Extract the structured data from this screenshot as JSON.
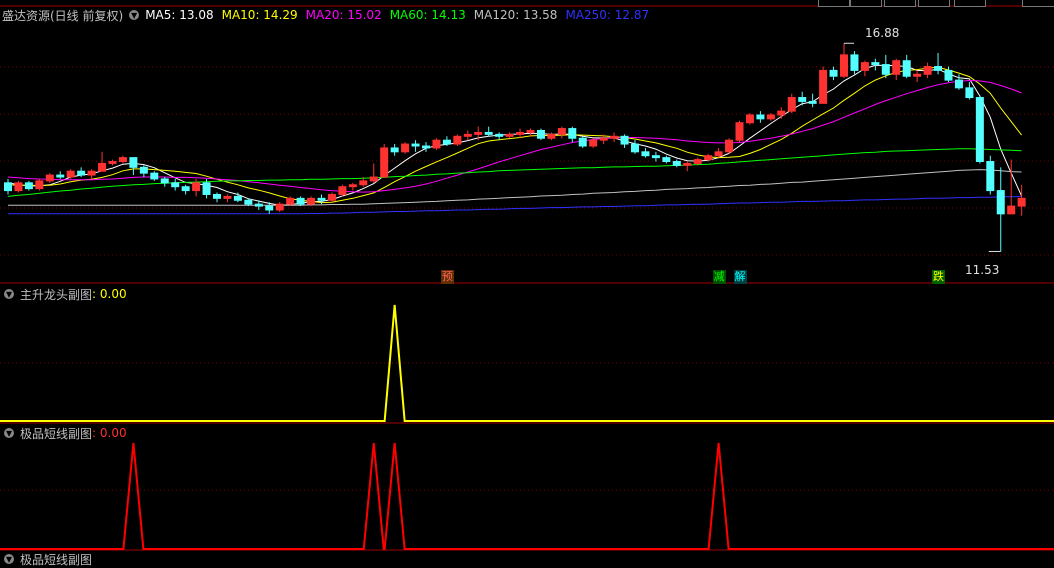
{
  "main": {
    "title": "盛达资源(日线 前复权)",
    "ma_labels": [
      {
        "name": "MA5",
        "text": "MA5: 13.08",
        "color": "#ffffff"
      },
      {
        "name": "MA10",
        "text": "MA10: 14.29",
        "color": "#ffff00"
      },
      {
        "name": "MA20",
        "text": "MA20: 15.02",
        "color": "#ff00ff"
      },
      {
        "name": "MA60",
        "text": "MA60: 14.13",
        "color": "#00ff00"
      },
      {
        "name": "MA120",
        "text": "MA120: 13.58",
        "color": "#c0c0c0"
      },
      {
        "name": "MA250",
        "text": "MA250: 12.87",
        "color": "#3030ff"
      }
    ],
    "high_label": "16.88",
    "low_label": "11.53",
    "signals": [
      {
        "text": "预",
        "color": "#ff6060",
        "bg": "#603000"
      },
      {
        "text": "减",
        "color": "#00ff00",
        "bg": "#005000"
      },
      {
        "text": "解",
        "color": "#00ffff",
        "bg": "#004040"
      },
      {
        "text": "跌",
        "color": "#ffff00",
        "bg": "#006000"
      }
    ]
  },
  "sub1": {
    "title": "主升龙头副图",
    "value": ": 0.00",
    "line_color": "#ffff00"
  },
  "sub2": {
    "title": "极品短线副图",
    "value": ": 0.00",
    "line_color": "#ff0000"
  },
  "sub3": {
    "title": "极品短线副图"
  },
  "chart_data": {
    "type": "candlestick",
    "y_range": [
      11.0,
      17.5
    ],
    "candles": [
      [
        13.3,
        13.4,
        13.0,
        13.1
      ],
      [
        13.1,
        13.35,
        13.05,
        13.3
      ],
      [
        13.3,
        13.35,
        13.1,
        13.15
      ],
      [
        13.15,
        13.4,
        13.1,
        13.35
      ],
      [
        13.35,
        13.55,
        13.3,
        13.5
      ],
      [
        13.5,
        13.6,
        13.4,
        13.45
      ],
      [
        13.45,
        13.65,
        13.4,
        13.6
      ],
      [
        13.6,
        13.7,
        13.45,
        13.5
      ],
      [
        13.5,
        13.65,
        13.4,
        13.6
      ],
      [
        13.6,
        14.1,
        13.6,
        13.8
      ],
      [
        13.8,
        13.9,
        13.75,
        13.85
      ],
      [
        13.85,
        14.0,
        13.8,
        13.95
      ],
      [
        13.95,
        13.95,
        13.5,
        13.7
      ],
      [
        13.7,
        13.75,
        13.45,
        13.55
      ],
      [
        13.55,
        13.6,
        13.35,
        13.4
      ],
      [
        13.4,
        13.45,
        13.2,
        13.3
      ],
      [
        13.3,
        13.4,
        13.1,
        13.2
      ],
      [
        13.2,
        13.25,
        13.0,
        13.1
      ],
      [
        13.1,
        13.4,
        12.95,
        13.3
      ],
      [
        13.3,
        13.4,
        12.9,
        13.0
      ],
      [
        13.0,
        13.05,
        12.8,
        12.9
      ],
      [
        12.9,
        13.0,
        12.8,
        12.95
      ],
      [
        12.95,
        13.05,
        12.8,
        12.85
      ],
      [
        12.85,
        12.9,
        12.7,
        12.75
      ],
      [
        12.75,
        12.85,
        12.6,
        12.7
      ],
      [
        12.7,
        12.8,
        12.5,
        12.6
      ],
      [
        12.6,
        12.8,
        12.55,
        12.75
      ],
      [
        12.75,
        12.95,
        12.7,
        12.9
      ],
      [
        12.9,
        12.95,
        12.7,
        12.75
      ],
      [
        12.75,
        12.95,
        12.7,
        12.9
      ],
      [
        12.9,
        13.0,
        12.75,
        12.85
      ],
      [
        12.85,
        13.05,
        12.8,
        13.0
      ],
      [
        13.0,
        13.25,
        12.95,
        13.2
      ],
      [
        13.2,
        13.3,
        13.1,
        13.25
      ],
      [
        13.25,
        13.45,
        13.2,
        13.35
      ],
      [
        13.35,
        13.8,
        13.3,
        13.45
      ],
      [
        13.45,
        14.3,
        13.45,
        14.2
      ],
      [
        14.2,
        14.3,
        14.0,
        14.1
      ],
      [
        14.1,
        14.35,
        14.05,
        14.3
      ],
      [
        14.3,
        14.4,
        14.1,
        14.25
      ],
      [
        14.25,
        14.35,
        14.1,
        14.2
      ],
      [
        14.2,
        14.45,
        14.15,
        14.4
      ],
      [
        14.4,
        14.5,
        14.25,
        14.3
      ],
      [
        14.3,
        14.55,
        14.25,
        14.5
      ],
      [
        14.5,
        14.65,
        14.4,
        14.55
      ],
      [
        14.55,
        14.75,
        14.4,
        14.6
      ],
      [
        14.6,
        14.75,
        14.5,
        14.55
      ],
      [
        14.55,
        14.6,
        14.4,
        14.5
      ],
      [
        14.5,
        14.6,
        14.45,
        14.55
      ],
      [
        14.55,
        14.7,
        14.45,
        14.6
      ],
      [
        14.6,
        14.7,
        14.5,
        14.65
      ],
      [
        14.65,
        14.7,
        14.4,
        14.45
      ],
      [
        14.45,
        14.6,
        14.4,
        14.55
      ],
      [
        14.55,
        14.75,
        14.45,
        14.7
      ],
      [
        14.7,
        14.75,
        14.35,
        14.45
      ],
      [
        14.45,
        14.5,
        14.2,
        14.25
      ],
      [
        14.25,
        14.45,
        14.2,
        14.4
      ],
      [
        14.4,
        14.55,
        14.3,
        14.45
      ],
      [
        14.45,
        14.6,
        14.35,
        14.5
      ],
      [
        14.5,
        14.55,
        14.2,
        14.3
      ],
      [
        14.3,
        14.4,
        14.05,
        14.1
      ],
      [
        14.1,
        14.2,
        13.95,
        14.0
      ],
      [
        14.0,
        14.1,
        13.85,
        13.95
      ],
      [
        13.95,
        14.0,
        13.8,
        13.85
      ],
      [
        13.85,
        13.9,
        13.7,
        13.75
      ],
      [
        13.75,
        13.85,
        13.6,
        13.8
      ],
      [
        13.8,
        13.95,
        13.75,
        13.9
      ],
      [
        13.9,
        14.05,
        13.85,
        14.0
      ],
      [
        14.0,
        14.2,
        13.95,
        14.1
      ],
      [
        14.1,
        14.45,
        14.05,
        14.4
      ],
      [
        14.4,
        14.9,
        14.35,
        14.85
      ],
      [
        14.85,
        15.1,
        14.8,
        15.05
      ],
      [
        15.05,
        15.15,
        14.85,
        14.95
      ],
      [
        14.95,
        15.1,
        14.9,
        15.05
      ],
      [
        15.05,
        15.25,
        14.95,
        15.15
      ],
      [
        15.15,
        15.6,
        15.1,
        15.5
      ],
      [
        15.5,
        15.65,
        15.3,
        15.4
      ],
      [
        15.4,
        15.6,
        15.25,
        15.35
      ],
      [
        15.35,
        16.3,
        15.35,
        16.2
      ],
      [
        16.2,
        16.3,
        15.95,
        16.05
      ],
      [
        16.05,
        16.9,
        16.0,
        16.6
      ],
      [
        16.6,
        16.7,
        16.1,
        16.2
      ],
      [
        16.2,
        16.45,
        16.05,
        16.4
      ],
      [
        16.4,
        16.5,
        16.2,
        16.35
      ],
      [
        16.35,
        16.6,
        16.0,
        16.1
      ],
      [
        16.1,
        16.5,
        15.95,
        16.45
      ],
      [
        16.45,
        16.6,
        16.0,
        16.05
      ],
      [
        16.05,
        16.2,
        15.9,
        16.1
      ],
      [
        16.1,
        16.4,
        16.0,
        16.3
      ],
      [
        16.3,
        16.65,
        16.1,
        16.2
      ],
      [
        16.2,
        16.3,
        15.9,
        15.95
      ],
      [
        15.95,
        16.1,
        15.7,
        15.75
      ],
      [
        15.75,
        15.9,
        15.45,
        15.5
      ],
      [
        15.5,
        15.55,
        13.8,
        13.85
      ],
      [
        13.85,
        14.0,
        13.0,
        13.1
      ],
      [
        13.1,
        13.7,
        11.53,
        12.5
      ],
      [
        12.5,
        13.9,
        12.5,
        12.7
      ],
      [
        12.7,
        13.25,
        12.45,
        12.9
      ]
    ],
    "ma": {
      "MA5": [
        13.3,
        13.25,
        13.22,
        13.22,
        13.25,
        13.34,
        13.45,
        13.5,
        13.53,
        13.61,
        13.68,
        13.78,
        13.8,
        13.77,
        13.69,
        13.56,
        13.43,
        13.31,
        13.28,
        13.24,
        13.18,
        13.07,
        13.0,
        12.89,
        12.83,
        12.77,
        12.72,
        12.73,
        12.78,
        12.81,
        12.82,
        12.87,
        12.96,
        13.04,
        13.15,
        13.28,
        13.49,
        13.68,
        13.87,
        14.05,
        14.19,
        14.26,
        14.29,
        14.33,
        14.39,
        14.46,
        14.5,
        14.53,
        14.55,
        14.56,
        14.58,
        14.57,
        14.55,
        14.56,
        14.55,
        14.5,
        14.46,
        14.46,
        14.46,
        14.38,
        14.31,
        14.25,
        14.17,
        14.04,
        13.94,
        13.87,
        13.86,
        13.88,
        13.95,
        14.06,
        14.25,
        14.45,
        14.64,
        14.83,
        15.01,
        15.19,
        15.34,
        15.39,
        15.57,
        15.72,
        15.93,
        16.08,
        16.25,
        16.33,
        16.33,
        16.32,
        16.3,
        16.2,
        16.19,
        16.23,
        16.11,
        16.01,
        15.98,
        15.54,
        14.99,
        14.17,
        13.55,
        12.96
      ],
      "MA10": [
        13.25,
        13.24,
        13.24,
        13.23,
        13.24,
        13.27,
        13.33,
        13.37,
        13.39,
        13.44,
        13.51,
        13.61,
        13.66,
        13.66,
        13.64,
        13.62,
        13.6,
        13.57,
        13.54,
        13.47,
        13.39,
        13.32,
        13.25,
        13.17,
        13.11,
        13.04,
        12.96,
        12.89,
        12.85,
        12.82,
        12.79,
        12.8,
        12.85,
        12.9,
        12.97,
        13.04,
        13.18,
        13.33,
        13.46,
        13.6,
        13.72,
        13.84,
        13.95,
        14.07,
        14.19,
        14.31,
        14.38,
        14.41,
        14.44,
        14.47,
        14.51,
        14.52,
        14.52,
        14.53,
        14.54,
        14.53,
        14.52,
        14.51,
        14.49,
        14.47,
        14.43,
        14.38,
        14.33,
        14.26,
        14.19,
        14.09,
        14.02,
        13.97,
        13.95,
        13.96,
        13.98,
        14.06,
        14.16,
        14.29,
        14.42,
        14.58,
        14.76,
        14.92,
        15.08,
        15.23,
        15.43,
        15.61,
        15.8,
        15.95,
        16.06,
        16.15,
        16.2,
        16.22,
        16.26,
        16.28,
        16.21,
        16.13,
        16.04,
        15.85,
        15.61,
        15.23,
        14.88,
        14.53
      ],
      "MA20": [
        13.45,
        13.43,
        13.41,
        13.4,
        13.39,
        13.38,
        13.38,
        13.38,
        13.38,
        13.39,
        13.4,
        13.42,
        13.44,
        13.45,
        13.45,
        13.45,
        13.44,
        13.44,
        13.43,
        13.42,
        13.4,
        13.38,
        13.36,
        13.33,
        13.3,
        13.27,
        13.24,
        13.21,
        13.18,
        13.15,
        13.12,
        13.1,
        13.08,
        13.07,
        13.06,
        13.07,
        13.1,
        13.13,
        13.17,
        13.21,
        13.27,
        13.34,
        13.42,
        13.5,
        13.58,
        13.66,
        13.75,
        13.84,
        13.92,
        14.0,
        14.08,
        14.16,
        14.22,
        14.28,
        14.34,
        14.38,
        14.42,
        14.44,
        14.46,
        14.47,
        14.47,
        14.46,
        14.45,
        14.43,
        14.41,
        14.38,
        14.36,
        14.34,
        14.33,
        14.33,
        14.34,
        14.37,
        14.41,
        14.45,
        14.5,
        14.56,
        14.63,
        14.7,
        14.79,
        14.88,
        14.99,
        15.1,
        15.21,
        15.32,
        15.42,
        15.51,
        15.6,
        15.68,
        15.76,
        15.83,
        15.88,
        15.92,
        15.94,
        15.93,
        15.89,
        15.81,
        15.72,
        15.62
      ],
      "MA60": [
        12.95,
        12.98,
        13.0,
        13.03,
        13.06,
        13.09,
        13.11,
        13.14,
        13.16,
        13.19,
        13.21,
        13.23,
        13.25,
        13.26,
        13.28,
        13.29,
        13.3,
        13.31,
        13.32,
        13.33,
        13.34,
        13.35,
        13.35,
        13.36,
        13.36,
        13.37,
        13.37,
        13.38,
        13.38,
        13.39,
        13.39,
        13.4,
        13.41,
        13.41,
        13.42,
        13.43,
        13.44,
        13.46,
        13.47,
        13.49,
        13.5,
        13.52,
        13.53,
        13.55,
        13.56,
        13.58,
        13.59,
        13.61,
        13.62,
        13.63,
        13.64,
        13.65,
        13.66,
        13.67,
        13.68,
        13.69,
        13.69,
        13.7,
        13.71,
        13.71,
        13.72,
        13.73,
        13.73,
        13.74,
        13.75,
        13.76,
        13.77,
        13.78,
        13.8,
        13.82,
        13.84,
        13.86,
        13.88,
        13.9,
        13.92,
        13.94,
        13.96,
        13.98,
        14.0,
        14.02,
        14.04,
        14.06,
        14.08,
        14.09,
        14.11,
        14.12,
        14.13,
        14.14,
        14.15,
        14.16,
        14.17,
        14.18,
        14.18,
        14.17,
        14.16,
        14.15,
        14.14,
        14.13
      ],
      "MA120": [
        12.72,
        12.72,
        12.72,
        12.72,
        12.72,
        12.72,
        12.72,
        12.72,
        12.72,
        12.72,
        12.72,
        12.72,
        12.72,
        12.72,
        12.72,
        12.72,
        12.72,
        12.72,
        12.72,
        12.72,
        12.72,
        12.72,
        12.72,
        12.72,
        12.72,
        12.72,
        12.72,
        12.72,
        12.72,
        12.73,
        12.73,
        12.74,
        12.74,
        12.75,
        12.75,
        12.76,
        12.77,
        12.78,
        12.79,
        12.8,
        12.81,
        12.82,
        12.84,
        12.85,
        12.86,
        12.88,
        12.89,
        12.9,
        12.92,
        12.93,
        12.94,
        12.96,
        12.97,
        12.98,
        13.0,
        13.01,
        13.03,
        13.04,
        13.05,
        13.07,
        13.08,
        13.1,
        13.11,
        13.13,
        13.14,
        13.15,
        13.17,
        13.18,
        13.2,
        13.21,
        13.23,
        13.24,
        13.26,
        13.27,
        13.29,
        13.31,
        13.32,
        13.34,
        13.36,
        13.38,
        13.4,
        13.42,
        13.44,
        13.46,
        13.48,
        13.5,
        13.52,
        13.54,
        13.56,
        13.58,
        13.6,
        13.62,
        13.63,
        13.64,
        13.63,
        13.61,
        13.59,
        13.58
      ],
      "MA250": [
        12.5,
        12.5,
        12.5,
        12.5,
        12.5,
        12.5,
        12.5,
        12.5,
        12.5,
        12.5,
        12.5,
        12.5,
        12.5,
        12.5,
        12.5,
        12.5,
        12.5,
        12.5,
        12.5,
        12.5,
        12.5,
        12.5,
        12.5,
        12.5,
        12.5,
        12.5,
        12.5,
        12.5,
        12.5,
        12.51,
        12.51,
        12.52,
        12.52,
        12.53,
        12.54,
        12.54,
        12.55,
        12.56,
        12.56,
        12.57,
        12.58,
        12.58,
        12.59,
        12.6,
        12.6,
        12.61,
        12.62,
        12.62,
        12.63,
        12.64,
        12.64,
        12.65,
        12.66,
        12.66,
        12.67,
        12.68,
        12.68,
        12.69,
        12.69,
        12.7,
        12.71,
        12.71,
        12.72,
        12.73,
        12.73,
        12.74,
        12.75,
        12.75,
        12.76,
        12.77,
        12.78,
        12.78,
        12.79,
        12.8,
        12.8,
        12.81,
        12.82,
        12.82,
        12.83,
        12.84,
        12.84,
        12.85,
        12.86,
        12.86,
        12.87,
        12.88,
        12.88,
        12.89,
        12.9,
        12.9,
        12.91,
        12.92,
        12.92,
        12.93,
        12.93,
        12.94,
        12.94,
        12.95
      ]
    },
    "signal_index": {
      "预": 42,
      "减": 68,
      "解": 70,
      "跌": 89
    },
    "high_index": 80,
    "low_index": 95,
    "sub1_spikes": [
      {
        "index": 37,
        "value": 1
      }
    ],
    "sub2_spikes": [
      {
        "index": 12,
        "value": 1
      },
      {
        "index": 35,
        "value": 1
      },
      {
        "index": 37,
        "value": 1
      },
      {
        "index": 68,
        "value": 1
      }
    ]
  }
}
